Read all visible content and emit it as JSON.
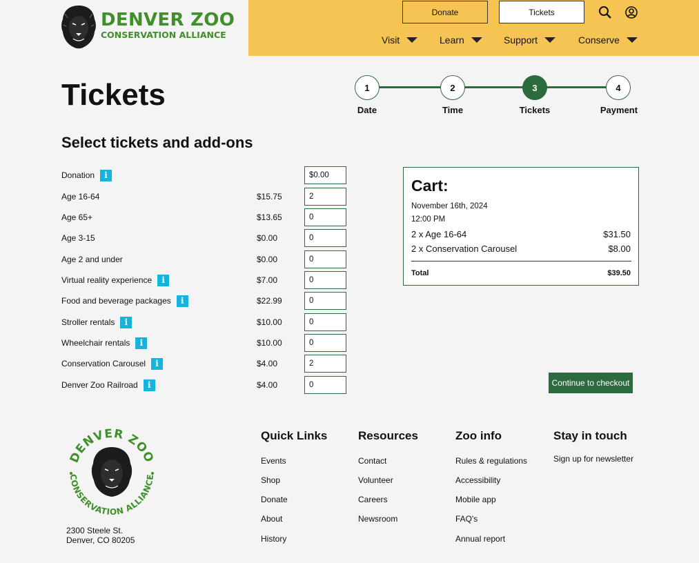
{
  "header": {
    "logo_title": "DENVER ZOO",
    "logo_subtitle": "CONSERVATION ALLIANCE",
    "donate_label": "Donate",
    "tickets_label": "Tickets",
    "nav": [
      "Visit",
      "Learn",
      "Support",
      "Conserve"
    ],
    "icons": [
      "search-icon",
      "account-icon"
    ]
  },
  "page": {
    "title": "Tickets",
    "section_title": "Select tickets and add-ons"
  },
  "steps": [
    {
      "num": "1",
      "label": "Date",
      "active": false
    },
    {
      "num": "2",
      "label": "Time",
      "active": false
    },
    {
      "num": "3",
      "label": "Tickets",
      "active": true
    },
    {
      "num": "4",
      "label": "Payment",
      "active": false
    }
  ],
  "tickets": [
    {
      "label": "Donation",
      "info": true,
      "price": "",
      "qty": "$0.00"
    },
    {
      "label": "Age 16-64",
      "info": false,
      "price": "$15.75",
      "qty": "2"
    },
    {
      "label": "Age 65+",
      "info": false,
      "price": "$13.65",
      "qty": "0"
    },
    {
      "label": "Age 3-15",
      "info": false,
      "price": "$0.00",
      "qty": "0"
    },
    {
      "label": "Age 2 and under",
      "info": false,
      "price": "$0.00",
      "qty": "0"
    },
    {
      "label": "Virtual reality experience",
      "info": true,
      "price": "$7.00",
      "qty": "0"
    },
    {
      "label": "Food and beverage packages",
      "info": true,
      "price": "$22.99",
      "qty": "0"
    },
    {
      "label": "Stroller rentals",
      "info": true,
      "price": "$10.00",
      "qty": "0"
    },
    {
      "label": "Wheelchair rentals",
      "info": true,
      "price": "$10.00",
      "qty": "0"
    },
    {
      "label": "Conservation Carousel",
      "info": true,
      "price": "$4.00",
      "qty": "2"
    },
    {
      "label": "Denver Zoo Railroad",
      "info": true,
      "price": "$4.00",
      "qty": "0"
    }
  ],
  "cart": {
    "title": "Cart:",
    "date": "November 16th, 2024",
    "time": "12:00 PM",
    "lines": [
      {
        "name": "2 x Age 16-64",
        "price": "$31.50"
      },
      {
        "name": "2 x Conservation Carousel",
        "price": "$8.00"
      }
    ],
    "total_label": "Total",
    "total_value": "$39.50"
  },
  "checkout_label": "Continue to checkout",
  "footer": {
    "badge_top": "DENVER ZOO",
    "badge_bottom": "CONSERVATION ALLIANCE",
    "address_line1": "2300 Steele St.",
    "address_line2": "Denver, CO 80205",
    "columns": [
      {
        "title": "Quick Links",
        "items": [
          "Events",
          "Shop",
          "Donate",
          "About",
          "History"
        ]
      },
      {
        "title": "Resources",
        "items": [
          "Contact",
          "Volunteer",
          "Careers",
          "Newsroom"
        ]
      },
      {
        "title": "Zoo info",
        "items": [
          "Rules & regulations",
          "Accessibility",
          "Mobile app",
          "FAQ's",
          "Annual report"
        ]
      },
      {
        "title": "Stay in touch",
        "items": [
          "Sign up for newsletter"
        ]
      }
    ]
  },
  "colors": {
    "brand_yellow": "#f6c453",
    "brand_green": "#2d6a3e",
    "logo_green": "#3f8f2a",
    "info_blue": "#16b3dd"
  }
}
